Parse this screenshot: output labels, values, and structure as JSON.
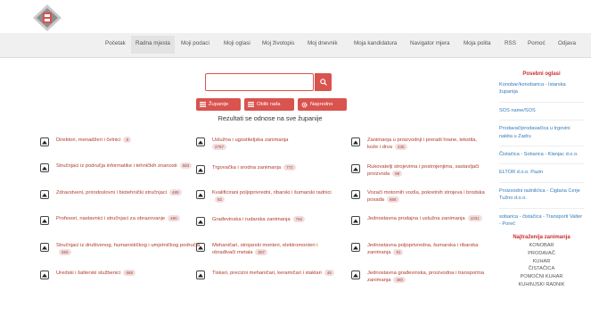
{
  "header": {
    "logo_icon": "rm-logo-icon"
  },
  "nav": {
    "items": [
      {
        "label": "Početak",
        "active": false
      },
      {
        "label": "Radna mjesta",
        "active": true
      },
      {
        "label": "Moji podaci",
        "active": false
      },
      {
        "label": "Moji oglasi",
        "active": false
      },
      {
        "label": "Moj životopis",
        "active": false
      },
      {
        "label": "Moj dnevnik",
        "active": false
      },
      {
        "label": "Moja kandidatura",
        "active": false
      },
      {
        "label": "Navigator mjera",
        "active": false
      },
      {
        "label": "Moja polita",
        "active": false
      },
      {
        "label": "RSS",
        "active": false
      },
      {
        "label": "Pomoć",
        "active": false
      },
      {
        "label": "Odjava",
        "active": false
      }
    ]
  },
  "search": {
    "value": "",
    "placeholder": "",
    "button_icon": "search-icon"
  },
  "filters": {
    "zupanije": "Županije",
    "oblik_rada": "Oblik rada",
    "napredno": "Napredno"
  },
  "results_text": "Rezultati se odnose na sve županije",
  "categories": [
    {
      "label": "Direktori, menadžeri i čelnici",
      "count": "8"
    },
    {
      "label": "Stručnjaci iz područja informatike i tehničkih znanosti",
      "count": "583"
    },
    {
      "label": "Zdravstveni, prirodoslovni i biotehnički stručnjaci",
      "count": "489"
    },
    {
      "label": "Profesori, nastavnici i stručnjaci za obrazovanje",
      "count": "480"
    },
    {
      "label": "Stručnjaci iz društvenog, humanističkog i umjetničkog područja",
      "count": "550"
    },
    {
      "label": "Uredski i šalterski službenici",
      "count": "668"
    },
    {
      "label": "Uslužna i ugostiteljska zanimanja",
      "count": "2787"
    },
    {
      "label": "Trgovačka i srodna zanimanja",
      "count": "772"
    },
    {
      "label": "Kvalificirani poljoprivredni, ribarski i šumarski radnici",
      "count": "82"
    },
    {
      "label": "Građevinska i rudarska zanimanja",
      "count": "792"
    },
    {
      "label": "Mehaničari, strojarski monteri, elektromonteri i obrađivači metala",
      "count": "507"
    },
    {
      "label": "Tiskari, precizni mehaničari, keramičari i staklari",
      "count": "46"
    },
    {
      "label": "Zanimanja u proizvodnji i preradi hrane, tekstila, kože i drva",
      "count": "435"
    },
    {
      "label": "Rukovatelji strojevima i postrojenjima, sastavljači proizvoda",
      "count": "98"
    },
    {
      "label": "Vozači motornih vozila, pokretnih strojeva i brodska posada",
      "count": "868"
    },
    {
      "label": "Jednostavna prodajna i uslužna zanimanja",
      "count": "1031"
    },
    {
      "label": "Jednostavna poljoprivredna, šumarska i ribarska zanimanja",
      "count": "81"
    },
    {
      "label": "Jednostavna građevinska, proizvodna i transportna zanimanja",
      "count": "480"
    }
  ],
  "sidebar": {
    "title": "Posebni oglasi",
    "links": [
      "Konobar/konobarica - Istarska županija",
      "SOS name/SOS",
      "Prodavač/prodavačica u trgovini nakita u Zadru",
      "Čistačica - Sobarica - Klanjac d.o.o.",
      "ELTOR d.o.o. Pazin",
      "Proizvodni radnik/ica - Cigtana Cerje Tužno d.o.o.",
      "sobarica - čistačica - Transporti Valter - Poreč"
    ],
    "title2": "Najtraženija zanimanja",
    "jobs": [
      "KONOBAR",
      "PRODAVAČ",
      "KUHAR",
      "ČISTAČICA",
      "POMOĆNI KUHAR",
      "KUHINJSKI RADNIK"
    ]
  },
  "colors": {
    "accent": "#d9534f",
    "link": "#337ab7",
    "category_text": "#b03a2e"
  }
}
